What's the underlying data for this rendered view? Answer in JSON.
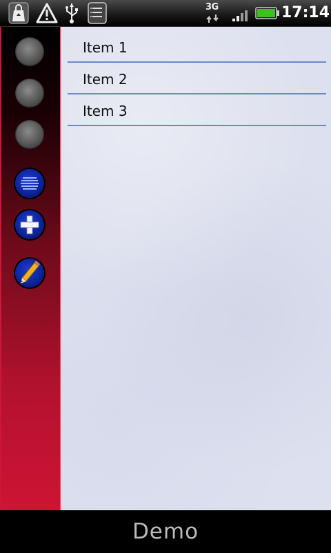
{
  "status_bar": {
    "icons": [
      "shopping-bag-icon",
      "warning-icon",
      "usb-icon",
      "notes-icon",
      "3g-data-icon",
      "signal-icon",
      "battery-icon"
    ],
    "network_label": "3G",
    "clock": "17:14",
    "battery_color": "#40c020"
  },
  "sidebar": {
    "buttons": [
      {
        "name": "sidebar-button-1",
        "icon": "gray-orb"
      },
      {
        "name": "sidebar-button-2",
        "icon": "gray-orb"
      },
      {
        "name": "sidebar-button-3",
        "icon": "gray-orb"
      },
      {
        "name": "list-view-button",
        "icon": "lines-icon"
      },
      {
        "name": "add-button",
        "icon": "plus-icon"
      },
      {
        "name": "edit-button",
        "icon": "pencil-icon"
      }
    ],
    "gradient_top": "#000000",
    "gradient_bottom": "#cd1434"
  },
  "list": {
    "items": [
      "Item 1",
      "Item 2",
      "Item 3"
    ],
    "divider_color": "#6a88cc"
  },
  "bottom_bar": {
    "title": "Demo"
  }
}
